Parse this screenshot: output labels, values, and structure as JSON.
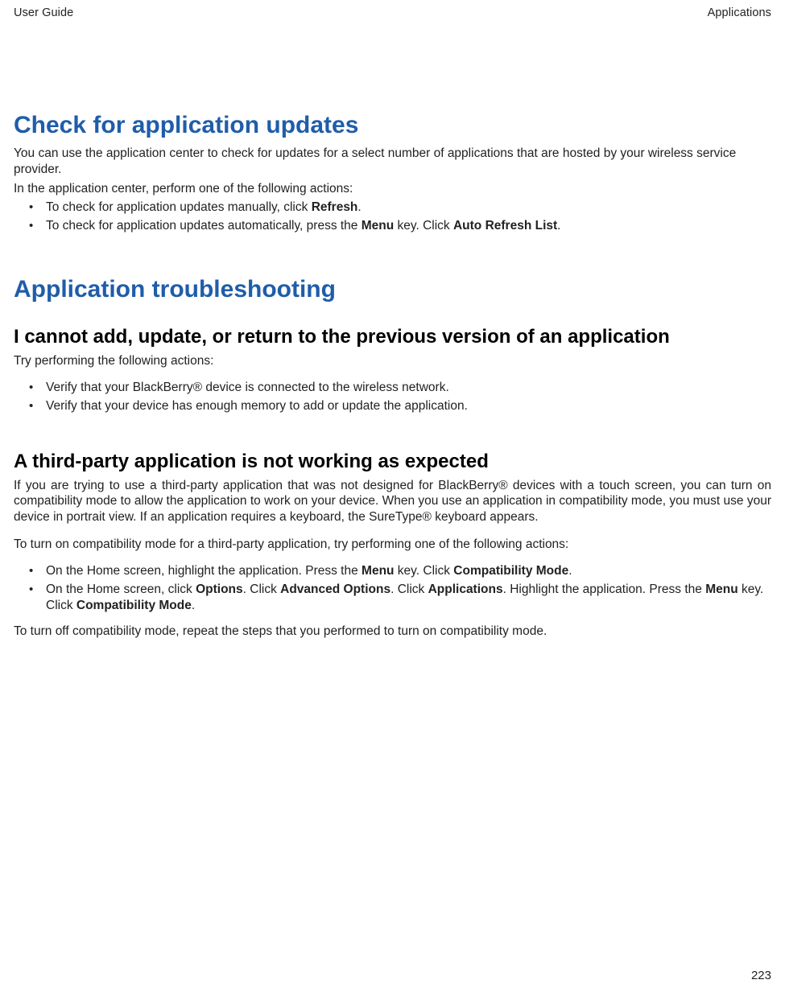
{
  "header": {
    "left": "User Guide",
    "right": "Applications"
  },
  "section1": {
    "title": "Check for application updates",
    "p1": "You can use the application center to check for updates for a select number of applications that are hosted by your wireless service provider.",
    "p2": "In the application center, perform one of the following actions:",
    "li1a": "To check for application updates manually, click ",
    "li1b": "Refresh",
    "li1c": ".",
    "li2a": "To check for application updates automatically, press the ",
    "li2b": "Menu",
    "li2c": " key. Click ",
    "li2d": "Auto Refresh List",
    "li2e": "."
  },
  "section2": {
    "title": "Application troubleshooting",
    "sub1": {
      "title": "I cannot add, update, or return to the previous version of an application",
      "p1": "Try performing the following actions:",
      "li1": "Verify that your BlackBerry® device is connected to the wireless network.",
      "li2": "Verify that your device has enough memory to add or update the application."
    },
    "sub2": {
      "title": "A third-party application is not working as expected",
      "p1": "If you are trying to use a third-party application that was not designed for BlackBerry® devices with a touch screen, you can turn on compatibility mode to allow the application to work on your device. When you use an application in compatibility mode, you must use your device in portrait view. If an application requires a keyboard, the SureType® keyboard appears.",
      "p2": "To turn on compatibility mode for a third-party application, try performing one of the following actions:",
      "li1a": "On the Home screen, highlight the application. Press the ",
      "li1b": "Menu",
      "li1c": " key. Click ",
      "li1d": "Compatibility Mode",
      "li1e": ".",
      "li2a": "On the Home screen, click ",
      "li2b": "Options",
      "li2c": ". Click ",
      "li2d": "Advanced Options",
      "li2e": ". Click ",
      "li2f": "Applications",
      "li2g": ". Highlight the application. Press the ",
      "li2h": "Menu",
      "li2i": " key. Click ",
      "li2j": "Compatibility Mode",
      "li2k": ".",
      "p3": "To turn off compatibility mode, repeat the steps that you performed to turn on compatibility mode."
    }
  },
  "page_number": "223"
}
